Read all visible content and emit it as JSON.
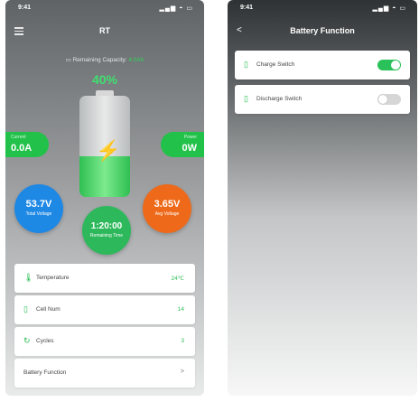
{
  "left_screen": {
    "status_time": "9:41",
    "status_icons": "▂▄▆ ◓ ▭",
    "title": "RT",
    "remaining_label": "Remaining Capacity:",
    "remaining_value": "4.0Ah",
    "percent": "40%",
    "battery_level": 0.4,
    "current": {
      "label": "Current",
      "value": "0.0A"
    },
    "power": {
      "label": "Power",
      "value": "0W"
    },
    "total_voltage": {
      "value": "53.7V",
      "label": "Total Voltage"
    },
    "remaining_time": {
      "value": "1:20:00",
      "label": "Remaining Time"
    },
    "avg_voltage": {
      "value": "3.65V",
      "label": "Avg Voltage"
    },
    "rows": [
      {
        "label": "Temperature",
        "value": "24℃"
      },
      {
        "label": "Cell Num",
        "value": "14"
      },
      {
        "label": "Cycles",
        "value": "3"
      },
      {
        "label": "Battery Function",
        "value": ">"
      }
    ]
  },
  "right_screen": {
    "status_time": "9:41",
    "status_icons": "▂▄▆ ◓ ▭",
    "back": "<",
    "title": "Battery Function",
    "rows": [
      {
        "label": "Charge Switch",
        "on": true
      },
      {
        "label": "Discharge Switch",
        "on": false
      }
    ]
  },
  "colors": {
    "accent_green": "#2bc15a",
    "blue": "#1e88e5",
    "orange": "#ee6a1a"
  }
}
